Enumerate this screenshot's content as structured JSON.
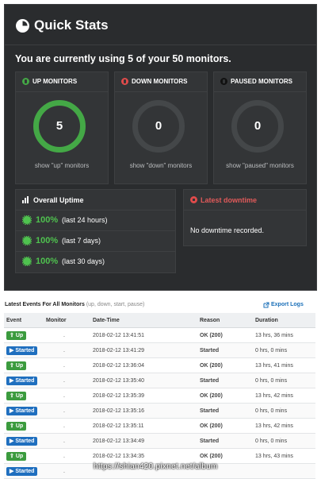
{
  "panel": {
    "title": "Quick Stats",
    "using": "You are currently using 5 of your 50 monitors."
  },
  "monitors": [
    {
      "title": "UP MONITORS",
      "value": "5",
      "link": "show \"up\" monitors",
      "color": "#44a846"
    },
    {
      "title": "DOWN MONITORS",
      "value": "0",
      "link": "show \"down\" monitors",
      "color": "#e04b4b"
    },
    {
      "title": "PAUSED MONITORS",
      "value": "0",
      "link": "show \"paused\" monitors",
      "color": "#111111"
    }
  ],
  "uptime": {
    "title": "Overall Uptime",
    "rows": [
      {
        "pct": "100%",
        "period": "(last 24 hours)"
      },
      {
        "pct": "100%",
        "period": "(last 7 days)"
      },
      {
        "pct": "100%",
        "period": "(last 30 days)"
      }
    ]
  },
  "downtime": {
    "title": "Latest downtime",
    "text": "No downtime recorded."
  },
  "events": {
    "title": "Latest Events For All Monitors",
    "subtitle": "(up, down, start, pause)",
    "export": "Export Logs",
    "columns": [
      "Event",
      "Monitor",
      "Date-Time",
      "Reason",
      "Duration"
    ],
    "rows": [
      {
        "event": "Up",
        "type": "up",
        "monitor": ".",
        "datetime": "2018-02-12 13:41:51",
        "reason": "OK (200)",
        "duration": "13 hrs, 36 mins"
      },
      {
        "event": "Started",
        "type": "started",
        "monitor": ".",
        "datetime": "2018-02-12 13:41:29",
        "reason": "Started",
        "duration": "0 hrs, 0 mins"
      },
      {
        "event": "Up",
        "type": "up",
        "monitor": ".",
        "datetime": "2018-02-12 13:36:04",
        "reason": "OK (200)",
        "duration": "13 hrs, 41 mins"
      },
      {
        "event": "Started",
        "type": "started",
        "monitor": ".",
        "datetime": "2018-02-12 13:35:40",
        "reason": "Started",
        "duration": "0 hrs, 0 mins"
      },
      {
        "event": "Up",
        "type": "up",
        "monitor": ".",
        "datetime": "2018-02-12 13:35:39",
        "reason": "OK (200)",
        "duration": "13 hrs, 42 mins"
      },
      {
        "event": "Started",
        "type": "started",
        "monitor": ".",
        "datetime": "2018-02-12 13:35:16",
        "reason": "Started",
        "duration": "0 hrs, 0 mins"
      },
      {
        "event": "Up",
        "type": "up",
        "monitor": ".",
        "datetime": "2018-02-12 13:35:11",
        "reason": "OK (200)",
        "duration": "13 hrs, 42 mins"
      },
      {
        "event": "Started",
        "type": "started",
        "monitor": ".",
        "datetime": "2018-02-12 13:34:49",
        "reason": "Started",
        "duration": "0 hrs, 0 mins"
      },
      {
        "event": "Up",
        "type": "up",
        "monitor": ".",
        "datetime": "2018-02-12 13:34:35",
        "reason": "OK (200)",
        "duration": "13 hrs, 43 mins"
      },
      {
        "event": "Started",
        "type": "started",
        "monitor": ".",
        "datetime": "",
        "reason": "",
        "duration": ""
      }
    ]
  },
  "watermark": "https://shian420.pixnet.net/album"
}
